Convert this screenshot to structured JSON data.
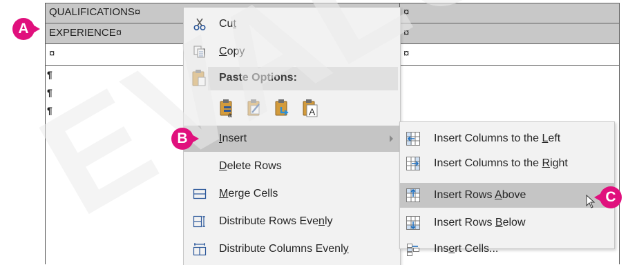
{
  "table": {
    "rows": [
      {
        "left": "QUALIFICATIONS¤",
        "right": "¤",
        "selected": true
      },
      {
        "left": "EXPERIENCE¤",
        "right": "¤",
        "selected": true
      },
      {
        "left": "¤",
        "right": "¤",
        "selected": false
      }
    ],
    "paragraph_marks": [
      "¶",
      "¶",
      "¶"
    ]
  },
  "callouts": {
    "a": "A",
    "b": "B",
    "c": "C",
    "color": "#e0107d"
  },
  "context_menu": {
    "cut": {
      "label_pre": "Cu",
      "label_u": "t",
      "icon": "scissors-icon"
    },
    "copy": {
      "label_u": "C",
      "label_post": "opy",
      "icon": "copy-icon"
    },
    "paste_options": {
      "label": "Paste Options:",
      "icon": "clipboard-icon",
      "options": [
        "keep-source-formatting-icon",
        "merge-formatting-icon",
        "paste-as-picture-icon",
        "keep-text-only-icon"
      ]
    },
    "insert": {
      "label_u": "I",
      "label_post": "nsert",
      "has_submenu": true
    },
    "delete_rows": {
      "label_u": "D",
      "label_post": "elete Rows"
    },
    "merge_cells": {
      "label_u": "M",
      "label_post": "erge Cells",
      "icon": "merge-cells-icon"
    },
    "distribute_rows": {
      "label_pre": "Distribute Rows Eve",
      "label_u": "n",
      "label_post": "ly",
      "icon": "distribute-rows-icon"
    },
    "distribute_columns": {
      "label_pre": "Distribute Columns Evenl",
      "label_u": "y",
      "icon": "distribute-columns-icon"
    }
  },
  "submenu": {
    "items": [
      {
        "pre": "Insert Columns to the ",
        "u": "L",
        "post": "eft",
        "icon": "insert-columns-left-icon"
      },
      {
        "pre": "Insert Columns to the ",
        "u": "R",
        "post": "ight",
        "icon": "insert-columns-right-icon"
      },
      {
        "pre": "Insert Rows ",
        "u": "A",
        "post": "bove",
        "icon": "insert-rows-above-icon",
        "highlighted": true
      },
      {
        "pre": "Insert Rows ",
        "u": "B",
        "post": "elow",
        "icon": "insert-rows-below-icon"
      },
      {
        "pre": "Ins",
        "u": "e",
        "post": "rt Cells...",
        "icon": "insert-cells-icon"
      }
    ]
  },
  "watermark": "EVALUATION"
}
